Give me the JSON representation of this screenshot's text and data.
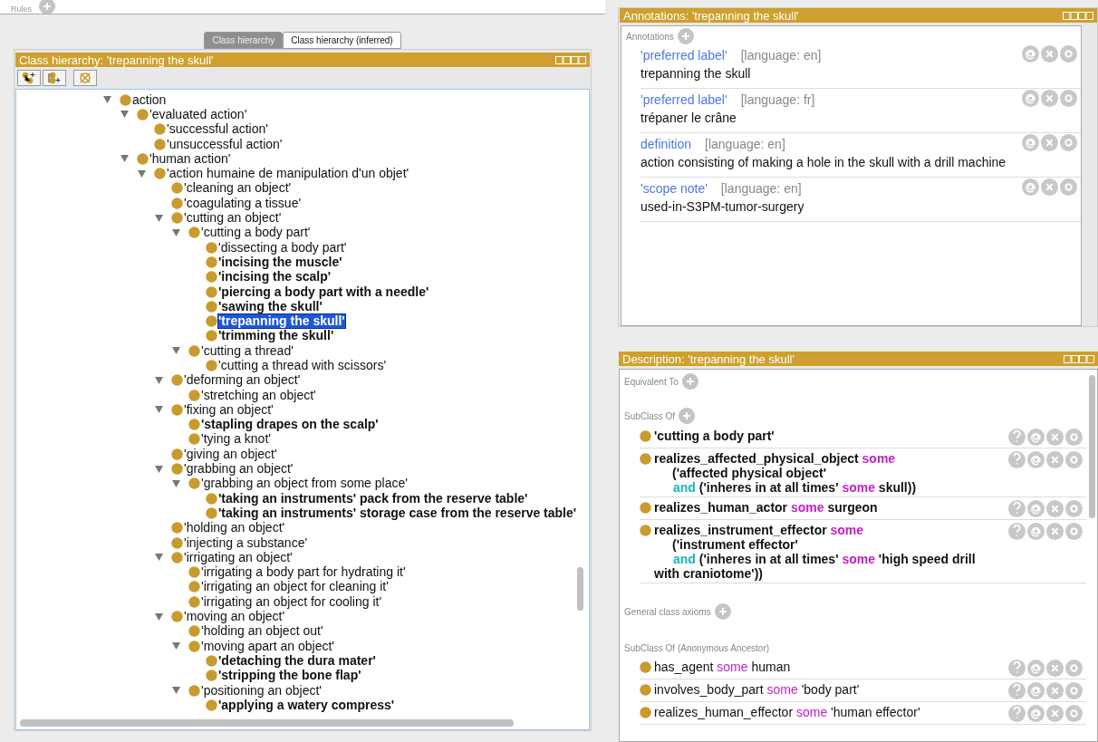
{
  "top_strip": {
    "label": "Rules"
  },
  "tabs": [
    {
      "label": "Class hierarchy",
      "selected": true
    },
    {
      "label": "Class hierarchy (inferred)",
      "selected": false
    }
  ],
  "hierarchy": {
    "title": "Class hierarchy: 'trepanning the skull'",
    "tree": [
      {
        "label": "action",
        "expanded": true,
        "bold": false,
        "selected": false,
        "children": [
          {
            "label": "'evaluated action'",
            "expanded": true,
            "bold": false,
            "selected": false,
            "children": [
              {
                "label": "'successful action'",
                "bold": false,
                "selected": false
              },
              {
                "label": "'unsuccessful action'",
                "bold": false,
                "selected": false
              }
            ]
          },
          {
            "label": "'human action'",
            "expanded": true,
            "bold": false,
            "selected": false,
            "children": [
              {
                "label": "'action humaine de manipulation d'un objet'",
                "expanded": true,
                "bold": false,
                "selected": false,
                "children": [
                  {
                    "label": "'cleaning an object'",
                    "bold": false,
                    "selected": false
                  },
                  {
                    "label": "'coagulating a tissue'",
                    "bold": false,
                    "selected": false
                  },
                  {
                    "label": "'cutting an object'",
                    "expanded": true,
                    "bold": false,
                    "selected": false,
                    "children": [
                      {
                        "label": "'cutting a body part'",
                        "expanded": true,
                        "bold": false,
                        "selected": false,
                        "children": [
                          {
                            "label": "'dissecting a body part'",
                            "bold": false,
                            "selected": false
                          },
                          {
                            "label": "'incising the muscle'",
                            "bold": true,
                            "selected": false
                          },
                          {
                            "label": "'incising the scalp'",
                            "bold": true,
                            "selected": false
                          },
                          {
                            "label": "'piercing a body part with a needle'",
                            "bold": true,
                            "selected": false
                          },
                          {
                            "label": "'sawing the skull'",
                            "bold": true,
                            "selected": false
                          },
                          {
                            "label": "'trepanning the skull'",
                            "bold": true,
                            "selected": true
                          },
                          {
                            "label": "'trimming the skull'",
                            "bold": true,
                            "selected": false
                          }
                        ]
                      },
                      {
                        "label": "'cutting a thread'",
                        "expanded": true,
                        "bold": false,
                        "selected": false,
                        "children": [
                          {
                            "label": "'cutting a thread with scissors'",
                            "bold": false,
                            "selected": false
                          }
                        ]
                      }
                    ]
                  },
                  {
                    "label": "'deforming an object'",
                    "expanded": true,
                    "bold": false,
                    "selected": false,
                    "children": [
                      {
                        "label": "'stretching an object'",
                        "bold": false,
                        "selected": false
                      }
                    ]
                  },
                  {
                    "label": "'fixing an object'",
                    "expanded": true,
                    "bold": false,
                    "selected": false,
                    "children": [
                      {
                        "label": "'stapling drapes on the scalp'",
                        "bold": true,
                        "selected": false
                      },
                      {
                        "label": "'tying a knot'",
                        "bold": false,
                        "selected": false
                      }
                    ]
                  },
                  {
                    "label": "'giving an object'",
                    "bold": false,
                    "selected": false
                  },
                  {
                    "label": "'grabbing an object'",
                    "expanded": true,
                    "bold": false,
                    "selected": false,
                    "children": [
                      {
                        "label": "'grabbing an object from some place'",
                        "expanded": true,
                        "bold": false,
                        "selected": false,
                        "children": [
                          {
                            "label": "'taking an instruments' pack from the reserve table'",
                            "bold": true,
                            "selected": false
                          },
                          {
                            "label": "'taking an instruments' storage case from the reserve table'",
                            "bold": true,
                            "selected": false
                          }
                        ]
                      }
                    ]
                  },
                  {
                    "label": "'holding an object'",
                    "bold": false,
                    "selected": false
                  },
                  {
                    "label": "'injecting a substance'",
                    "bold": false,
                    "selected": false
                  },
                  {
                    "label": "'irrigating an object'",
                    "expanded": true,
                    "bold": false,
                    "selected": false,
                    "children": [
                      {
                        "label": "'irrigating a body part for hydrating it'",
                        "bold": false,
                        "selected": false
                      },
                      {
                        "label": "'irrigating an object for cleaning it'",
                        "bold": false,
                        "selected": false
                      },
                      {
                        "label": "'irrigating an object for cooling it'",
                        "bold": false,
                        "selected": false
                      }
                    ]
                  },
                  {
                    "label": "'moving an object'",
                    "expanded": true,
                    "bold": false,
                    "selected": false,
                    "children": [
                      {
                        "label": "'holding an object out'",
                        "bold": false,
                        "selected": false
                      },
                      {
                        "label": "'moving apart an object'",
                        "expanded": true,
                        "bold": false,
                        "selected": false,
                        "children": [
                          {
                            "label": "'detaching the dura mater'",
                            "bold": true,
                            "selected": false
                          },
                          {
                            "label": "'stripping the bone flap'",
                            "bold": true,
                            "selected": false
                          }
                        ]
                      },
                      {
                        "label": "'positioning an object'",
                        "expanded": true,
                        "bold": false,
                        "selected": false,
                        "children": [
                          {
                            "label": "'applying a watery compress'",
                            "bold": true,
                            "selected": false
                          }
                        ]
                      }
                    ]
                  }
                ]
              }
            ]
          }
        ]
      }
    ]
  },
  "annotations": {
    "title": "Annotations: 'trepanning the skull'",
    "section": "Annotations",
    "items": [
      {
        "property": "'preferred label'",
        "language": "[language: en]",
        "value": "trepanning the skull"
      },
      {
        "property": "'preferred label'",
        "language": "[language: fr]",
        "value": "trépaner le crâne"
      },
      {
        "property": "definition",
        "language": "[language: en]",
        "value": "action consisting of making a hole in the skull with a drill machine"
      },
      {
        "property": "'scope note'",
        "language": "[language: en]",
        "value": "used-in-S3PM-tumor-surgery"
      }
    ]
  },
  "description": {
    "title": "Description: 'trepanning the skull'",
    "sections": [
      {
        "label": "Equivalent To",
        "add": true
      },
      {
        "label": "SubClass Of",
        "add": true,
        "axioms": [
          {
            "bold": true,
            "lines": [
              [
                {
                  "text": "'cutting a body part'",
                  "kind": "plain"
                }
              ]
            ]
          },
          {
            "bold": true,
            "lines": [
              [
                {
                  "text": "realizes_affected_physical_object",
                  "kind": "plain"
                },
                {
                  "text": "some",
                  "kind": "keyword"
                }
              ],
              [
                {
                  "text": "('affected physical object'",
                  "kind": "plain"
                }
              ],
              [
                {
                  "text": "and",
                  "kind": "connective"
                },
                {
                  "text": "('inheres in at all times'",
                  "kind": "plain"
                },
                {
                  "text": "some",
                  "kind": "keyword"
                },
                {
                  "text": "skull))",
                  "kind": "plain"
                }
              ]
            ]
          },
          {
            "bold": true,
            "lines": [
              [
                {
                  "text": "realizes_human_actor",
                  "kind": "plain"
                },
                {
                  "text": "some",
                  "kind": "keyword"
                },
                {
                  "text": "surgeon",
                  "kind": "plain"
                }
              ]
            ]
          },
          {
            "bold": true,
            "lines": [
              [
                {
                  "text": "realizes_instrument_effector",
                  "kind": "plain"
                },
                {
                  "text": "some",
                  "kind": "keyword"
                }
              ],
              [
                {
                  "text": "('instrument effector'",
                  "kind": "plain"
                }
              ],
              [
                {
                  "text": "and",
                  "kind": "connective"
                },
                {
                  "text": "('inheres in at all times'",
                  "kind": "plain"
                },
                {
                  "text": "some",
                  "kind": "keyword"
                },
                {
                  "text": "'high speed drill",
                  "kind": "plain"
                }
              ],
              [
                {
                  "text": "with craniotome'))",
                  "kind": "plain"
                }
              ]
            ]
          }
        ]
      },
      {
        "label": "General class axioms",
        "add": true
      },
      {
        "label": "SubClass Of (Anonymous Ancestor)",
        "add": false,
        "axioms": [
          {
            "bold": false,
            "lines": [
              [
                {
                  "text": "has_agent",
                  "kind": "plain"
                },
                {
                  "text": "some",
                  "kind": "keyword"
                },
                {
                  "text": "human",
                  "kind": "plain"
                }
              ]
            ]
          },
          {
            "bold": false,
            "lines": [
              [
                {
                  "text": "involves_body_part",
                  "kind": "plain"
                },
                {
                  "text": "some",
                  "kind": "keyword"
                },
                {
                  "text": "'body part'",
                  "kind": "plain"
                }
              ]
            ]
          },
          {
            "bold": false,
            "lines": [
              [
                {
                  "text": "realizes_human_effector",
                  "kind": "plain"
                },
                {
                  "text": "some",
                  "kind": "keyword"
                },
                {
                  "text": "'human effector'",
                  "kind": "plain"
                }
              ]
            ]
          }
        ]
      }
    ]
  }
}
